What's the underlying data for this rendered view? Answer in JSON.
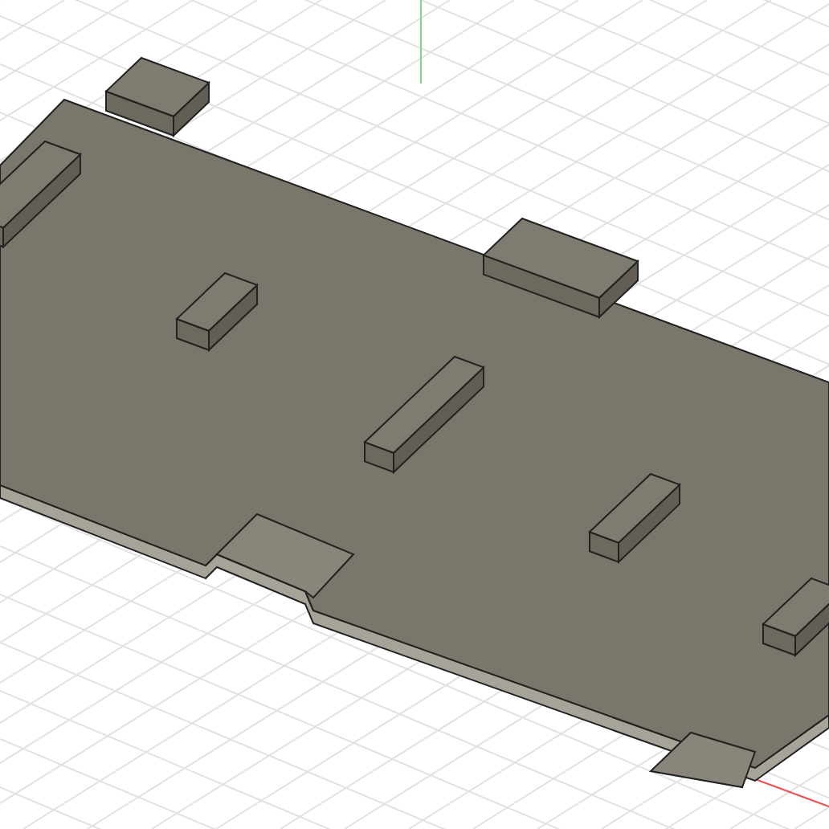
{
  "viewport": {
    "kind": "cad-viewport"
  }
}
